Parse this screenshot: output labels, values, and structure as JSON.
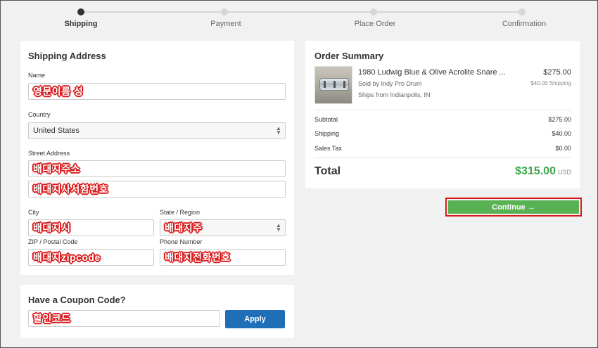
{
  "stepper": {
    "steps": [
      {
        "label": "Shipping",
        "active": true
      },
      {
        "label": "Payment",
        "active": false
      },
      {
        "label": "Place Order",
        "active": false
      },
      {
        "label": "Confirmation",
        "active": false
      }
    ]
  },
  "shipping": {
    "title": "Shipping Address",
    "name_label": "Name",
    "name_value": "영문이름 성",
    "country_label": "Country",
    "country_value": "United States",
    "street_label": "Street Address",
    "street1_value": "배대지주소",
    "street2_value": "배대지사서함번호",
    "city_label": "City",
    "city_value": "배대지시",
    "state_label": "State / Region",
    "state_value": "배대지주",
    "zip_label": "ZIP / Postal Code",
    "zip_value": "배대지zipcode",
    "phone_label": "Phone Number",
    "phone_value": "배대지전화번호"
  },
  "coupon": {
    "title": "Have a Coupon Code?",
    "value": "할인코드",
    "apply_label": "Apply"
  },
  "summary": {
    "title": "Order Summary",
    "item": {
      "title": "1980 Ludwig Blue & Olive Acrolite Snare ...",
      "seller": "Sold by Indy Pro Drum",
      "ships_from": "Ships from Indianpolis, IN",
      "price": "$275.00",
      "shipping": "$40.00 Shipping"
    },
    "rows": [
      {
        "label": "Subtotal",
        "value": "$275.00"
      },
      {
        "label": "Shipping",
        "value": "$40.00"
      },
      {
        "label": "Sales Tax",
        "value": "$0.00"
      }
    ],
    "total_label": "Total",
    "total_value": "$315.00",
    "currency": "USD"
  },
  "actions": {
    "continue_label": "Continue →"
  },
  "colors": {
    "accent_green": "#58b152",
    "total_green": "#3da64a",
    "apply_blue": "#1e6fb7",
    "highlight_red": "#d8191a"
  }
}
